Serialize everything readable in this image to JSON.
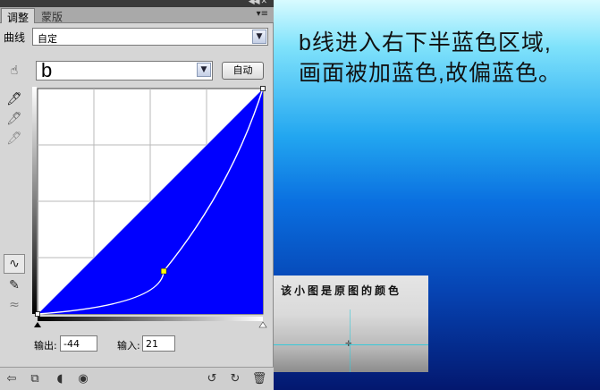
{
  "panel": {
    "tabs": [
      {
        "label": "调整",
        "active": true
      },
      {
        "label": "蒙版",
        "active": false
      }
    ],
    "preset_label": "曲线",
    "preset_value": "自定",
    "channel_value": "b",
    "auto_button": "自动",
    "output_label": "输出:",
    "output_value": "-44",
    "input_label": "输入:",
    "input_value": "21"
  },
  "curve": {
    "input_range": [
      0,
      100
    ],
    "point": {
      "input": 21,
      "output": -44
    },
    "grid": true,
    "fill_color": "#0000ff"
  },
  "image": {
    "caption_line1": "b线进入右下半蓝色区域,",
    "caption_line2": "画面被加蓝色,故偏蓝色。",
    "inset_label": "该小图是原图的颜色"
  },
  "colors": {
    "accent_blue": "#0000ff",
    "curve_point": "#ffff00",
    "guide_cyan": "#39c9d8"
  }
}
